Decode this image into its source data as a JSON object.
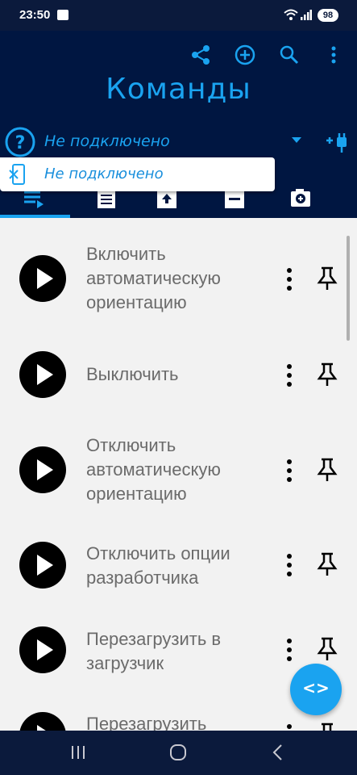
{
  "status": {
    "time": "23:50",
    "battery": "98"
  },
  "app": {
    "title": "Команды",
    "connection_status": "Не подключено"
  },
  "popup": {
    "text": "Не подключено"
  },
  "actions": [
    "share-icon",
    "add-circle-icon",
    "search-icon",
    "more-vert-icon"
  ],
  "tabs": [
    "list-icon",
    "receipt-icon",
    "upload-box-icon",
    "minus-box-icon",
    "camera-add-icon"
  ],
  "commands": [
    {
      "label": "Включить автоматическую ориентацию"
    },
    {
      "label": "Выключить"
    },
    {
      "label": "Отключить автоматическую ориентацию"
    },
    {
      "label": "Отключить опции разработчика"
    },
    {
      "label": "Перезагрузить в загрузчик"
    },
    {
      "label": "Перезагрузить"
    }
  ],
  "fab": {
    "label": "<>"
  },
  "colors": {
    "header_bg": "#001641",
    "accent": "#1aa3f0",
    "list_bg": "#f2f2f2"
  }
}
